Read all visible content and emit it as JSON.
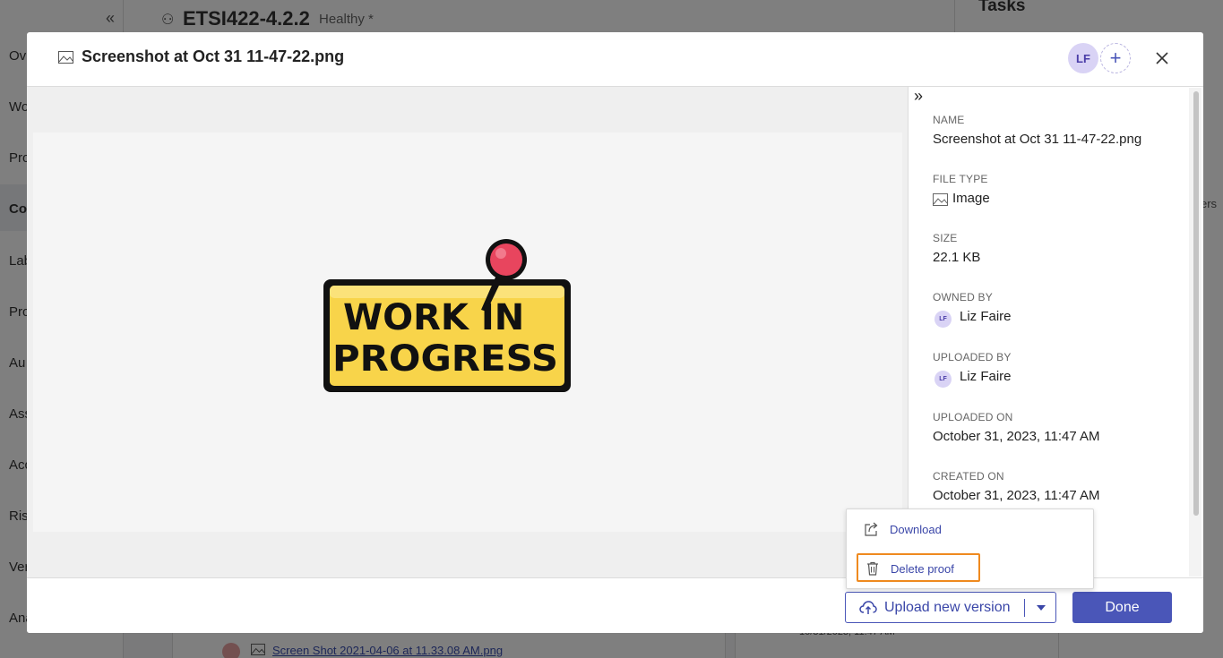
{
  "background": {
    "nav_items": [
      "Ov",
      "Wo",
      "Pro",
      "Co",
      "Lab",
      "Pro",
      "Au",
      "Ass",
      "Acc",
      "Ris",
      "Ver",
      "Ana"
    ],
    "title": "ETSI422-4.2.2",
    "health": "Healthy *",
    "tasks": "Tasks",
    "users_fragment": "ers",
    "file_link": "Screen Shot 2021-04-06 at 11.33.08 AM.png",
    "file_date": "10/31/2023, 11:47 AM"
  },
  "modal": {
    "title": "Screenshot at Oct 31 11-47-22.png",
    "avatar_initials": "LF",
    "preview": {
      "line1": "WORK IN",
      "line2": "PROGRESS"
    },
    "details": {
      "name_label": "NAME",
      "name_value": "Screenshot at Oct 31 11-47-22.png",
      "file_type_label": "FILE TYPE",
      "file_type_value": "Image",
      "size_label": "SIZE",
      "size_value": "22.1 KB",
      "owned_by_label": "OWNED BY",
      "owned_by_initials": "LF",
      "owned_by_value": "Liz Faire",
      "uploaded_by_label": "UPLOADED BY",
      "uploaded_by_initials": "LF",
      "uploaded_by_value": "Liz Faire",
      "uploaded_on_label": "UPLOADED ON",
      "uploaded_on_value": "October 31, 2023, 11:47 AM",
      "created_on_label": "CREATED ON",
      "created_on_value": "October 31, 2023, 11:47 AM"
    },
    "footer": {
      "upload_label": "Upload new version",
      "done_label": "Done"
    },
    "menu": {
      "download_label": "Download",
      "delete_label": "Delete proof"
    }
  },
  "colors": {
    "accent": "#4a56b8",
    "highlight": "#ef8a1f",
    "avatar_bg": "#d9d3f5"
  }
}
